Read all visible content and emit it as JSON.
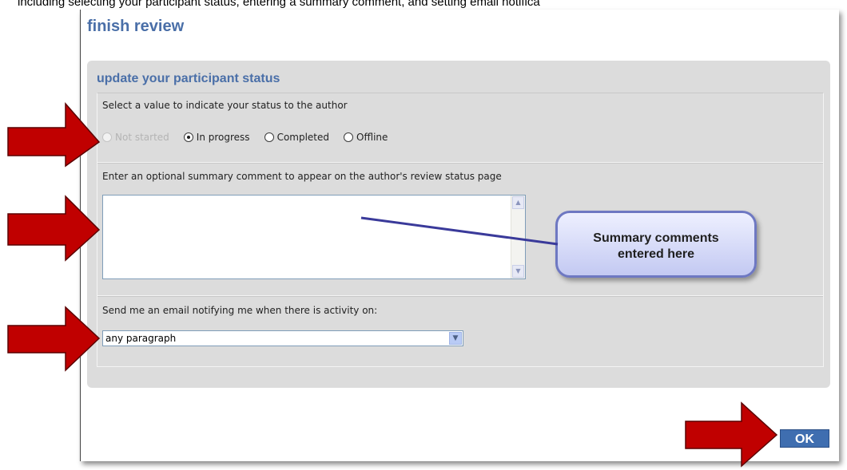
{
  "caption": "including selecting your participant status, entering a summary comment, and setting email notifica",
  "dialog": {
    "title": "finish review",
    "section_title": "update your participant status",
    "status": {
      "label": "Select a value to indicate your status to the author",
      "options": [
        {
          "label": "Not started",
          "selected": false,
          "disabled": true
        },
        {
          "label": "In progress",
          "selected": true,
          "disabled": false
        },
        {
          "label": "Completed",
          "selected": false,
          "disabled": false
        },
        {
          "label": "Offline",
          "selected": false,
          "disabled": false
        }
      ]
    },
    "comment": {
      "label": "Enter an optional summary comment to appear on the author's review status page",
      "value": ""
    },
    "email": {
      "label": "Send me an email notifying me when there is activity on:",
      "selected": "any paragraph"
    },
    "ok_label": "OK"
  },
  "callout": {
    "line1": "Summary comments",
    "line2": "entered here"
  },
  "colors": {
    "title_blue": "#4a6fa8",
    "arrow_red": "#c00000",
    "ok_button": "#3f6eb0",
    "callout_border": "#6e78c2"
  }
}
